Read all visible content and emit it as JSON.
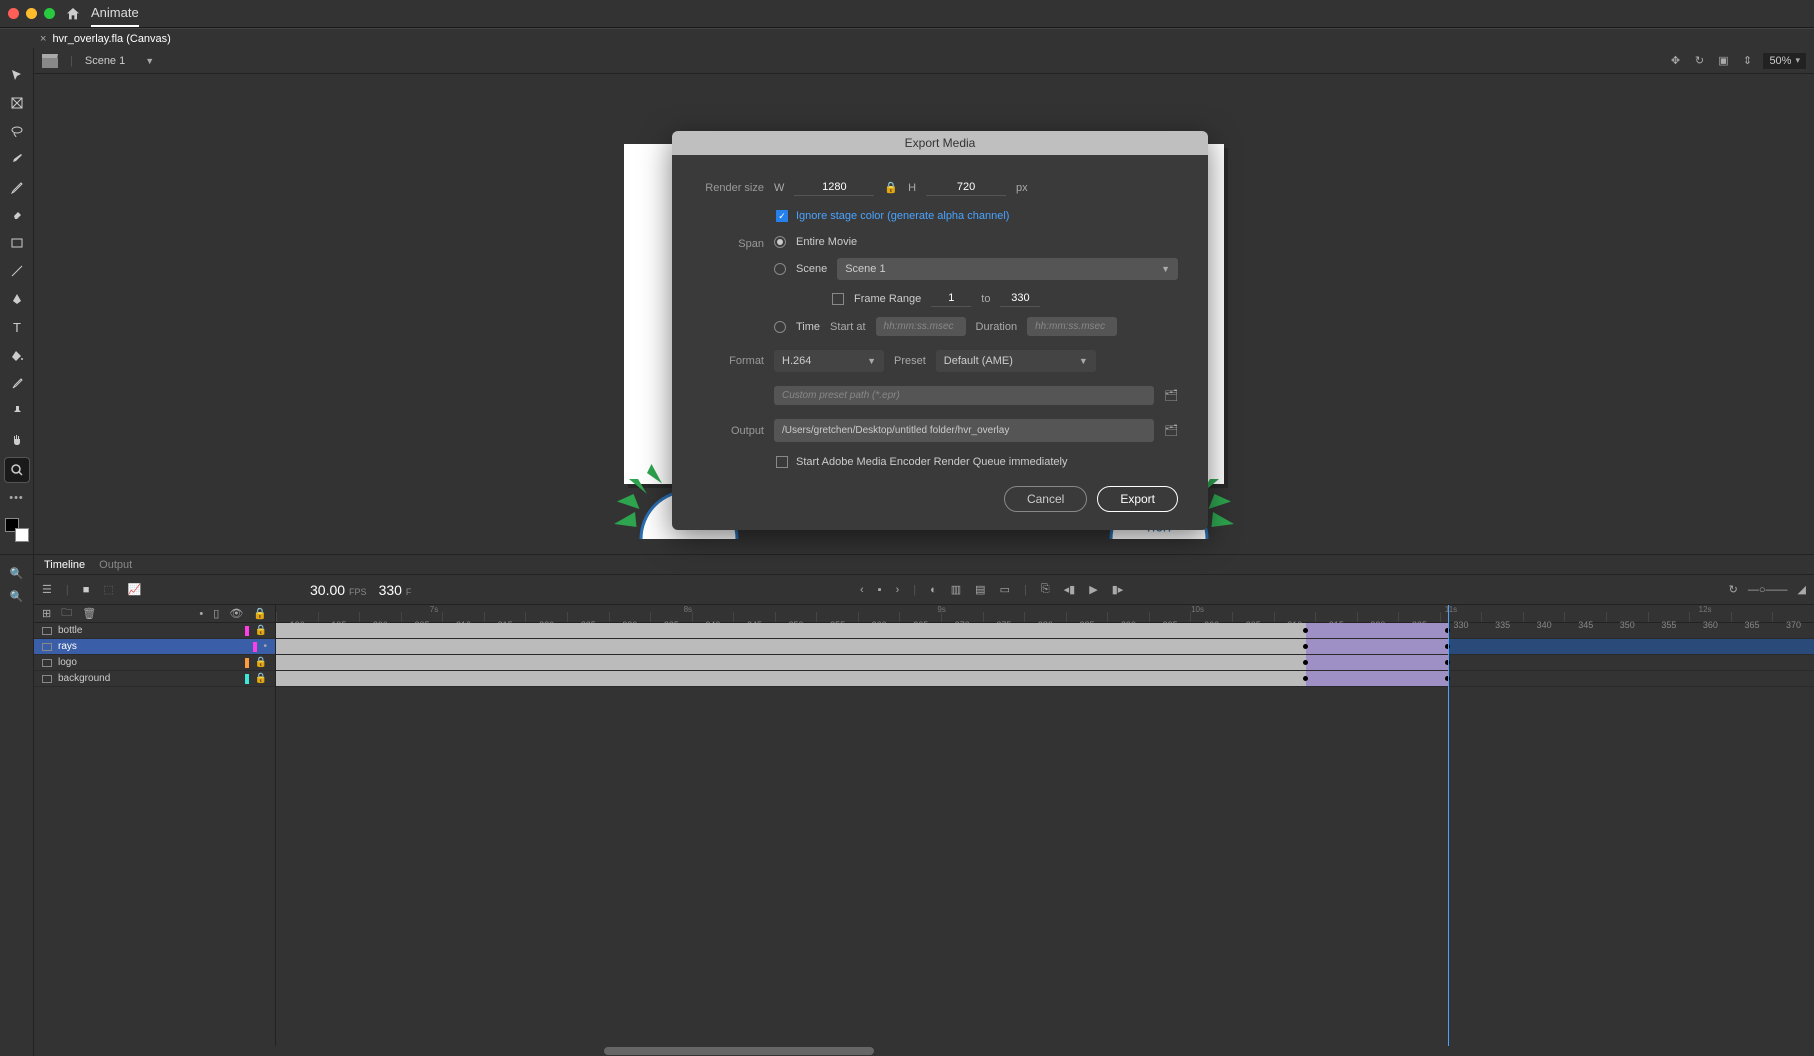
{
  "app": {
    "name": "Animate"
  },
  "document": {
    "tab_label": "hvr_overlay.fla (Canvas)"
  },
  "scene": {
    "current": "Scene 1",
    "zoom": "50%"
  },
  "toolbar_icons": [
    "selection",
    "free-transform",
    "lasso",
    "brush",
    "pencil",
    "eraser",
    "rectangle",
    "line",
    "pen",
    "text",
    "paint-bucket",
    "eyedropper",
    "pushpin",
    "hand",
    "zoom"
  ],
  "timeline": {
    "tabs": {
      "timeline": "Timeline",
      "output": "Output"
    },
    "fps": "30.00",
    "fps_label": "FPS",
    "frame": "330",
    "frame_label": "F",
    "ruler_seconds": [
      "7s",
      "8s",
      "9s",
      "10s",
      "11s",
      "12s"
    ],
    "ruler_frames": [
      "190",
      "195",
      "200",
      "205",
      "210",
      "215",
      "220",
      "225",
      "230",
      "235",
      "240",
      "245",
      "250",
      "255",
      "260",
      "265",
      "270",
      "275",
      "280",
      "285",
      "290",
      "295",
      "300",
      "305",
      "310",
      "315",
      "320",
      "325",
      "330",
      "335",
      "340",
      "345",
      "350",
      "355",
      "360",
      "365",
      "370"
    ],
    "layers": [
      {
        "name": "bottle",
        "color": "#ff3ee8",
        "locked": true,
        "selected": false
      },
      {
        "name": "rays",
        "color": "#ff3ee8",
        "locked": false,
        "selected": true
      },
      {
        "name": "logo",
        "color": "#ff9a3e",
        "locked": true,
        "selected": false
      },
      {
        "name": "background",
        "color": "#3ee8d8",
        "locked": true,
        "selected": false
      }
    ]
  },
  "modal": {
    "title": "Export Media",
    "render_size_label": "Render size",
    "w_label": "W",
    "width": "1280",
    "h_label": "H",
    "height": "720",
    "px_label": "px",
    "ignore_stage_label": "Ignore stage color (generate alpha channel)",
    "span_label": "Span",
    "span_entire": "Entire Movie",
    "span_scene": "Scene",
    "scene_select": "Scene 1",
    "frame_range_label": "Frame Range",
    "frame_from": "1",
    "frame_to_label": "to",
    "frame_to": "330",
    "span_time": "Time",
    "start_at_label": "Start at",
    "time_ph": "hh:mm:ss.msec",
    "duration_label": "Duration",
    "format_label": "Format",
    "format_value": "H.264",
    "preset_label": "Preset",
    "preset_value": "Default (AME)",
    "custom_preset_ph": "Custom preset path (*.epr)",
    "output_label": "Output",
    "output_path": "/Users/gretchen/Desktop/untitled folder/hvr_overlay",
    "start_ame_label": "Start Adobe Media Encoder Render Queue immediately",
    "cancel": "Cancel",
    "export": "Export"
  }
}
